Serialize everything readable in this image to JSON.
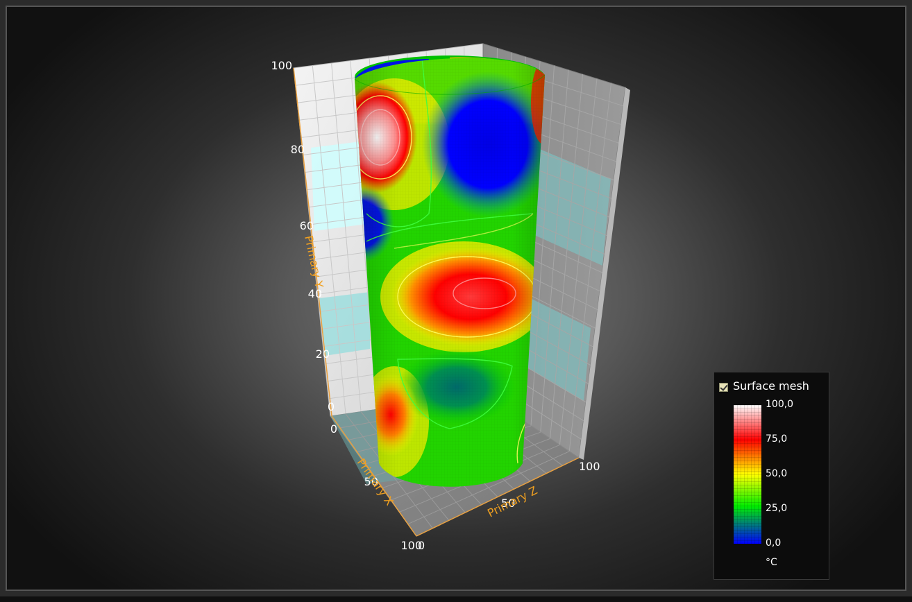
{
  "chart_data": {
    "type": "surface",
    "shape": "cylinder",
    "axes": {
      "x": {
        "title": "Primary X",
        "range": [
          0,
          100
        ],
        "ticks": [
          "0",
          "50",
          "100"
        ]
      },
      "y": {
        "title": "Primary Y",
        "range": [
          0,
          100
        ],
        "ticks": [
          "0",
          "20",
          "40",
          "60",
          "80",
          "100"
        ]
      },
      "z": {
        "title": "Primary Z",
        "range": [
          0,
          100
        ],
        "ticks": [
          "0",
          "50",
          "100"
        ]
      }
    },
    "legend": {
      "series_name": "Surface mesh",
      "checked": true,
      "labels": [
        "100,0",
        "75,0",
        "50,0",
        "25,0",
        "0,0"
      ],
      "unit": "°C",
      "palette": [
        {
          "value": 100,
          "color": "#ffffff"
        },
        {
          "value": 75,
          "color": "#ff0000"
        },
        {
          "value": 50,
          "color": "#ffff00"
        },
        {
          "value": 25,
          "color": "#00ee00"
        },
        {
          "value": 0,
          "color": "#0000ff"
        }
      ]
    }
  }
}
